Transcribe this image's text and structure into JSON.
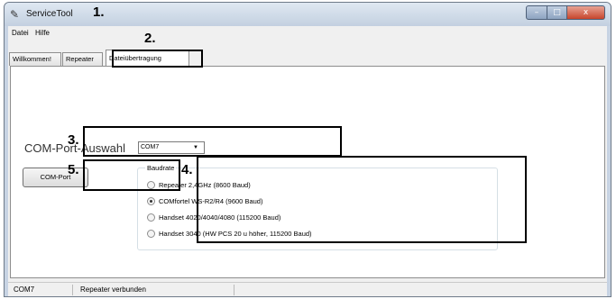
{
  "window": {
    "title": "ServiceTool",
    "controls": {
      "minimize": "–",
      "maximize": "□",
      "close": "x"
    }
  },
  "menubar": {
    "items": [
      "Datei",
      "Hilfe"
    ]
  },
  "tabs": [
    {
      "label": "Willkommen!",
      "active": false
    },
    {
      "label": "Repeater",
      "active": false
    },
    {
      "label": "Dateiübertragung",
      "active": true
    }
  ],
  "com_port": {
    "label": "COM-Port-Auswahl",
    "selected": "COM7",
    "button_label": "COM-Port"
  },
  "baudrate": {
    "legend": "Baudrate",
    "options": [
      {
        "label": "Repeater 2,4GHz (8600 Baud)",
        "checked": false
      },
      {
        "label": "COMfortel WS-R2/R4 (9600 Baud)",
        "checked": true
      },
      {
        "label": "Handset 4020/4040/4080 (115200 Baud)",
        "checked": false
      },
      {
        "label": "Handset 3040 (HW PCS 20 u höher, 115200 Baud)",
        "checked": false
      }
    ]
  },
  "statusbar": {
    "port": "COM7",
    "message": "Repeater verbunden"
  },
  "annotations": {
    "m1": "1.",
    "m2": "2.",
    "m3": "3.",
    "m4": "4.",
    "m5": "5."
  }
}
